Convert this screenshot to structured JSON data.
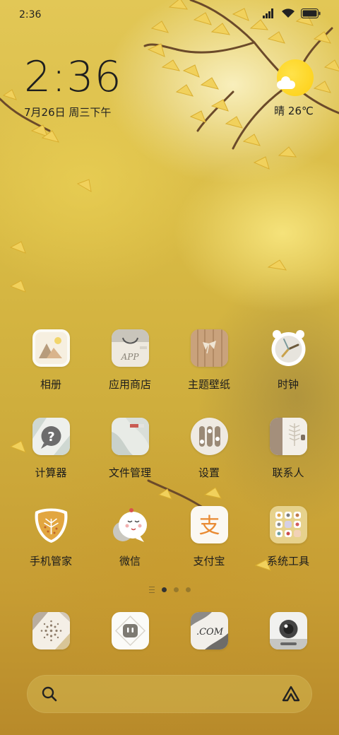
{
  "status_bar": {
    "time": "2:36",
    "icons": [
      "signal-icon",
      "wifi-icon",
      "battery-icon"
    ]
  },
  "clock_widget": {
    "time": "2:36",
    "date": "7月26日 周三下午"
  },
  "weather_widget": {
    "icon": "sunny-partly-cloudy-icon",
    "text": "晴 26℃"
  },
  "apps": [
    {
      "label": "相册",
      "icon": "gallery-icon"
    },
    {
      "label": "应用商店",
      "icon": "app-store-icon"
    },
    {
      "label": "主题壁纸",
      "icon": "themes-icon"
    },
    {
      "label": "时钟",
      "icon": "clock-icon"
    },
    {
      "label": "计算器",
      "icon": "calculator-icon"
    },
    {
      "label": "文件管理",
      "icon": "file-manager-icon"
    },
    {
      "label": "设置",
      "icon": "settings-icon"
    },
    {
      "label": "联系人",
      "icon": "contacts-icon"
    },
    {
      "label": "手机管家",
      "icon": "security-icon"
    },
    {
      "label": "微信",
      "icon": "wechat-icon"
    },
    {
      "label": "支付宝",
      "icon": "alipay-icon"
    },
    {
      "label": "系统工具",
      "icon": "system-tools-folder-icon"
    }
  ],
  "dock": [
    {
      "icon": "phone-dialer-icon",
      "text": ""
    },
    {
      "icon": "messages-icon",
      "text": ""
    },
    {
      "icon": "browser-icon",
      "text": ".COM"
    },
    {
      "icon": "camera-icon",
      "text": ""
    }
  ],
  "app_icon_texts": {
    "app_store": "APP",
    "calculator": "?",
    "alipay": "支"
  },
  "page_indicator": {
    "pages": 3,
    "current": 1
  },
  "search_bar": {
    "left_icon": "search-icon",
    "right_icon": "assistant-icon"
  },
  "colors": {
    "wallpaper_yellow": "#d9bb45",
    "sun": "#fdcf12",
    "leaf": "#f1d15c",
    "alipay_orange": "#e98b34",
    "text": "#1c1c1c"
  }
}
